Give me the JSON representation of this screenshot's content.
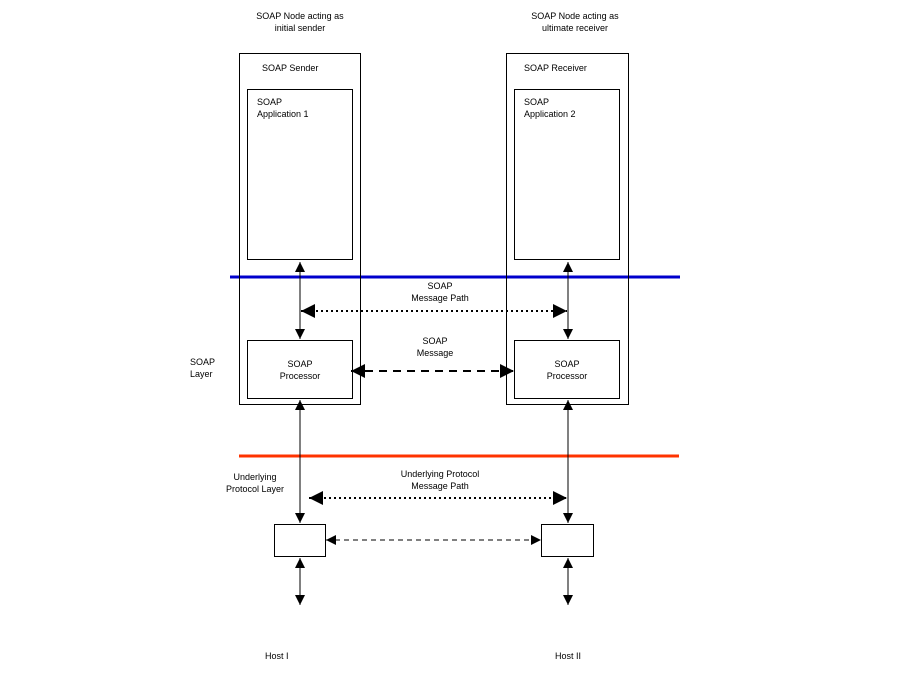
{
  "diagram": {
    "sender_node_title": [
      "SOAP Node acting as",
      "initial sender"
    ],
    "receiver_node_title": [
      "SOAP Node acting as",
      "ultimate receiver"
    ],
    "sender": {
      "label": "SOAP Sender",
      "application": [
        "SOAP",
        "Application 1"
      ],
      "processor": [
        "SOAP",
        "Processor"
      ]
    },
    "receiver": {
      "label": "SOAP Receiver",
      "application": [
        "SOAP",
        "Application 2"
      ],
      "processor": [
        "SOAP",
        "Processor"
      ]
    },
    "soap_layer": [
      "SOAP",
      "Layer"
    ],
    "soap_message_path": [
      "SOAP",
      "Message Path"
    ],
    "soap_message": [
      "SOAP",
      "Message"
    ],
    "underlying_layer": [
      "Underlying",
      "Protocol Layer"
    ],
    "underlying_message_path": [
      "Underlying Protocol",
      "Message Path"
    ],
    "host_1": "Host I",
    "host_2": "Host II",
    "colors": {
      "soap_layer_line": "#0000cc",
      "underlying_layer_line": "#ff3300",
      "stroke": "#000000"
    }
  }
}
